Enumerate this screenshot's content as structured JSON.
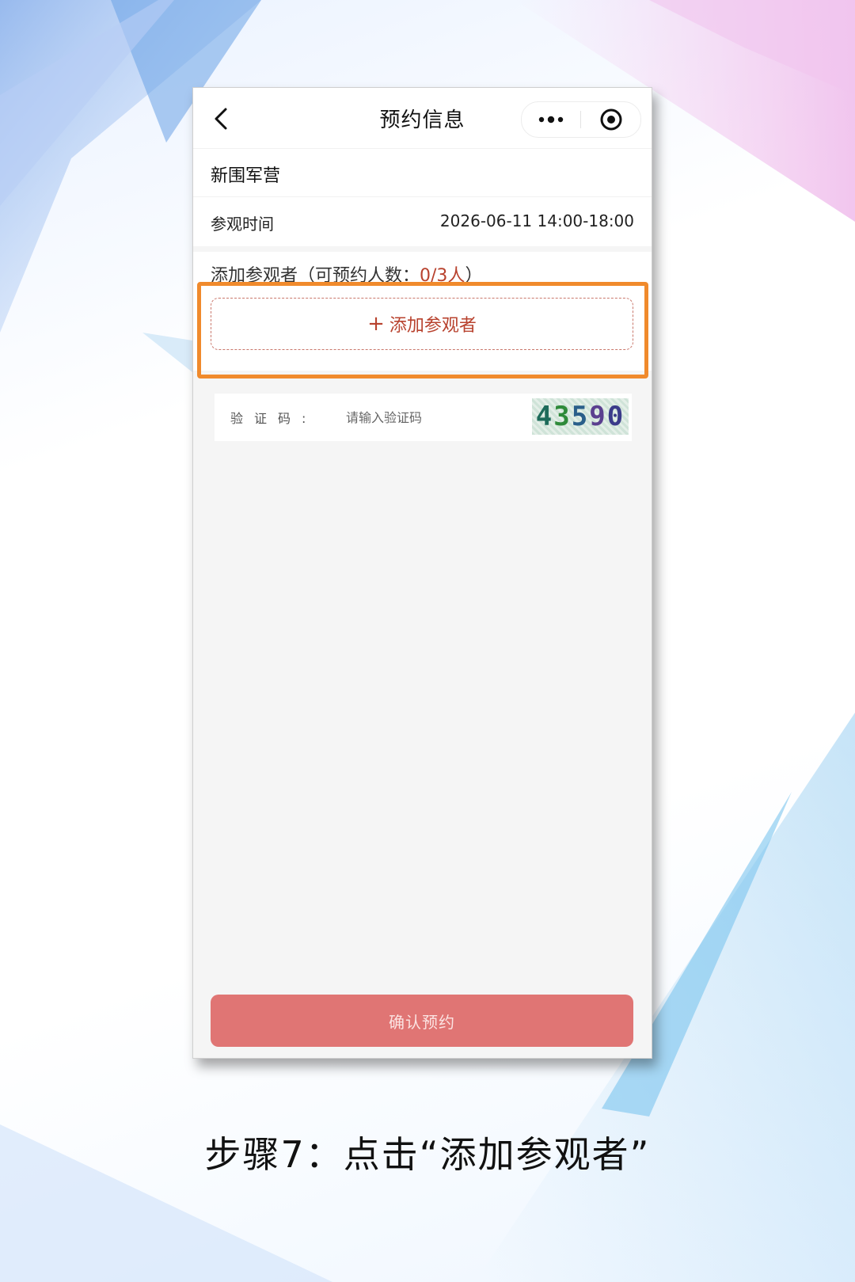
{
  "navbar": {
    "title": "预约信息",
    "back_icon": "chevron-left-icon",
    "more_icon": "more-dots-icon",
    "target_icon": "target-icon"
  },
  "venue": {
    "name": "新围军营"
  },
  "visit_time": {
    "label": "参观时间",
    "value": "2026-06-11 14:00-18:00"
  },
  "visitors": {
    "header_prefix": "添加参观者（可预约人数：",
    "count": "0/3人",
    "header_suffix": "）",
    "add_button_plus": "+",
    "add_button_label": "添加参观者"
  },
  "captcha": {
    "label": "验证码:",
    "placeholder": "请输入验证码",
    "code": [
      "4",
      "3",
      "5",
      "9",
      "0"
    ]
  },
  "confirm_button": {
    "label": "确认预约"
  },
  "caption": "步骤7：点击“添加参观者”",
  "colors": {
    "accent": "#b8422e",
    "confirm_bg": "#e07574",
    "highlight": "#f08a2c"
  }
}
